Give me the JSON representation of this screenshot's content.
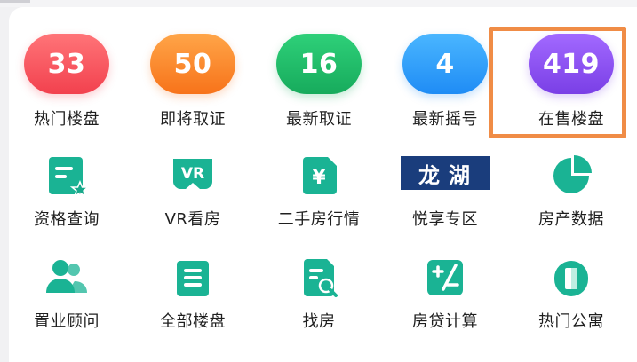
{
  "stats": [
    {
      "value": "33",
      "label": "热门楼盘",
      "color": "#f2414e"
    },
    {
      "value": "50",
      "label": "即将取证",
      "color": "#f7731a"
    },
    {
      "value": "16",
      "label": "最新取证",
      "color": "#17ab5c"
    },
    {
      "value": "4",
      "label": "最新摇号",
      "color": "#1f8cf5"
    },
    {
      "value": "419",
      "label": "在售楼盘",
      "color": "#7a3fe6"
    }
  ],
  "row2": [
    {
      "label": "资格查询",
      "icon": "qualification-check-icon"
    },
    {
      "label": "VR看房",
      "icon": "vr-icon",
      "icon_text": "VR"
    },
    {
      "label": "二手房行情",
      "icon": "yuan-price-icon",
      "icon_text": "¥"
    },
    {
      "label": "悦享专区",
      "icon": "longhu-brand-logo",
      "icon_text": "龙湖"
    },
    {
      "label": "房产数据",
      "icon": "pie-chart-icon"
    }
  ],
  "row3": [
    {
      "label": "置业顾问",
      "icon": "advisors-icon"
    },
    {
      "label": "全部楼盘",
      "icon": "building-list-icon"
    },
    {
      "label": "找房",
      "icon": "search-document-icon"
    },
    {
      "label": "房贷计算",
      "icon": "calculator-icon"
    },
    {
      "label": "热门公寓",
      "icon": "apartment-icon"
    }
  ],
  "accent_color": "#1ab394",
  "highlight_color": "#f08c46"
}
